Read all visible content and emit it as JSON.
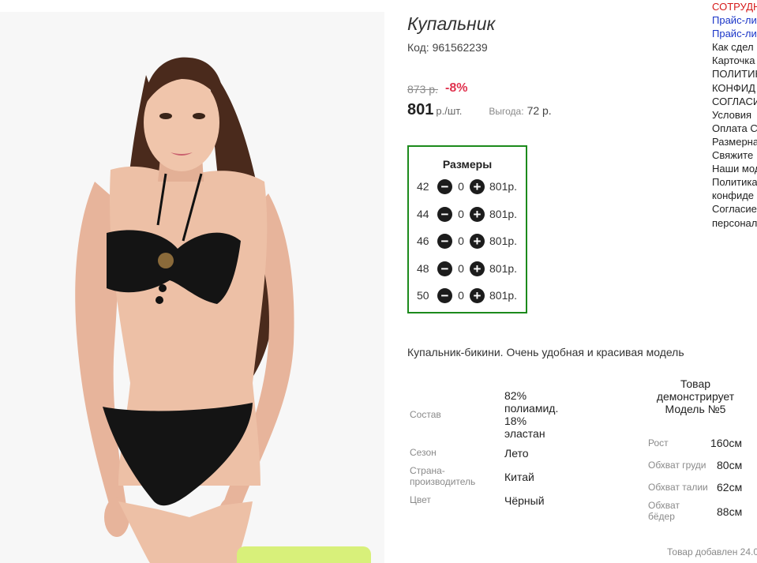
{
  "product": {
    "title": "Купальник",
    "sku": "Код: 961562239",
    "old_price": "873 р.",
    "discount": "-8%",
    "price": "801",
    "price_unit": "р./шт.",
    "savings_label": "Выгода:",
    "savings_value": "72 р."
  },
  "sizes": {
    "title": "Размеры",
    "rows": [
      {
        "size": "42",
        "qty": "0",
        "price": "801р."
      },
      {
        "size": "44",
        "qty": "0",
        "price": "801р."
      },
      {
        "size": "46",
        "qty": "0",
        "price": "801р."
      },
      {
        "size": "48",
        "qty": "0",
        "price": "801р."
      },
      {
        "size": "50",
        "qty": "0",
        "price": "801р."
      }
    ],
    "minus_icon": "minus-circle-icon",
    "plus_icon": "plus-circle-icon"
  },
  "description": "Купальник-бикини. Очень удобная и красивая модель",
  "specs": [
    {
      "label": "Состав",
      "value_lines": [
        "82%",
        "полиамид.",
        "18%",
        "эластан"
      ]
    },
    {
      "label": "Сезон",
      "value_lines": [
        "Лето"
      ]
    },
    {
      "label_lines": [
        "Страна-",
        "производитель"
      ],
      "value_lines": [
        "Китай"
      ]
    },
    {
      "label": "Цвет",
      "value_lines": [
        "Чёрный"
      ]
    }
  ],
  "model": {
    "heading_lines": [
      "Товар",
      "демонстрирует",
      "Модель №5"
    ],
    "rows": [
      {
        "label": "Рост",
        "value": "160см"
      },
      {
        "label": "Обхват груди",
        "value": "80см"
      },
      {
        "label": "Обхват талии",
        "value": "62см"
      },
      {
        "label_lines": [
          "Обхват",
          "бёдер"
        ],
        "value": "88см"
      }
    ]
  },
  "added_text": "Товар добавлен 24.0",
  "right_menu": [
    "СОТРУДН",
    "Прайс-ли",
    "Прайс-ли",
    "Как сдел",
    "Карточка",
    "ПОЛИТИК",
    "КОНФИД",
    "СОГЛАСИ",
    "Условия",
    "Оплата С",
    "Размерна",
    "Свяжите",
    "Наши мод",
    "Политика",
    "конфиде",
    "Согласие",
    "персонал"
  ],
  "colors": {
    "sizes_border": "#1c8a1c",
    "discount": "#e0334f",
    "menu_red": "#d61a1a",
    "menu_blue": "#1a35c8"
  }
}
